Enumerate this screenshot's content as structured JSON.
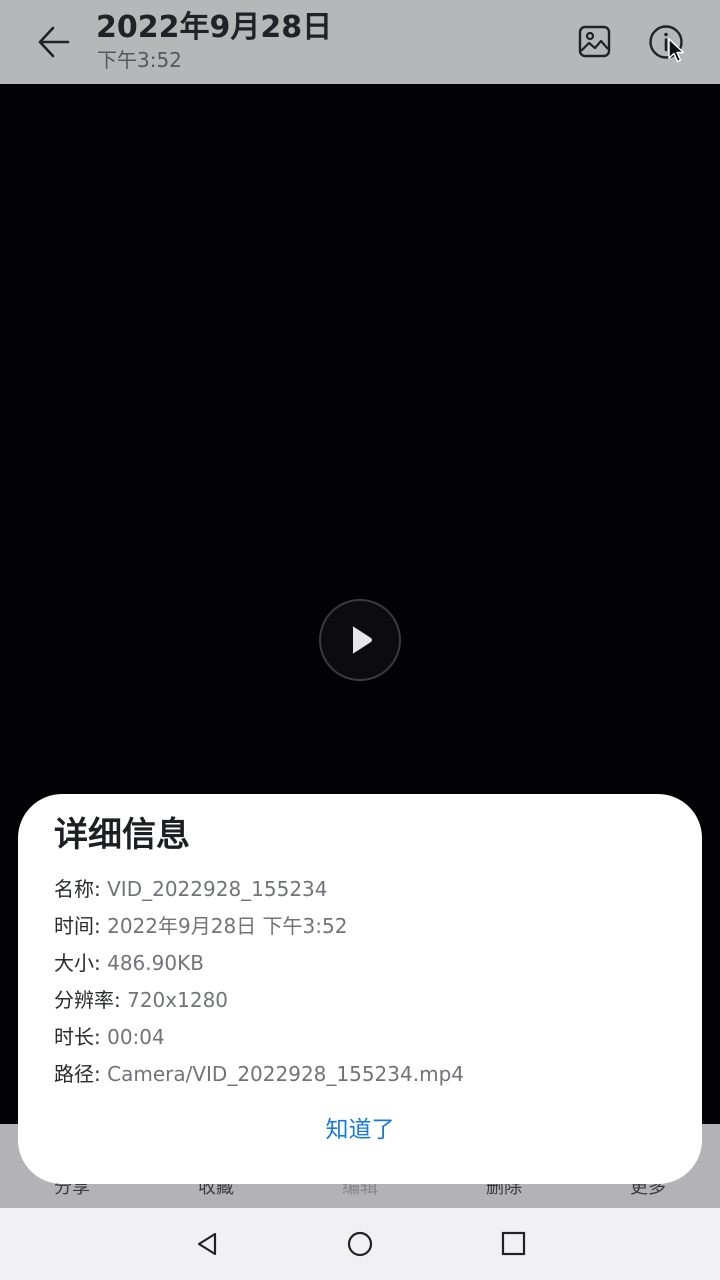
{
  "header": {
    "title": "2022年9月28日",
    "subtitle": "下午3:52",
    "icons": [
      "back-arrow-icon",
      "gallery-icon",
      "info-icon"
    ]
  },
  "video": {
    "play_icon": "play-icon"
  },
  "bottom_bar": {
    "items": [
      {
        "label": "分享"
      },
      {
        "label": "收藏"
      },
      {
        "label": "编辑"
      },
      {
        "label": "删除"
      },
      {
        "label": "更多"
      }
    ]
  },
  "dialog": {
    "title": "详细信息",
    "rows": [
      {
        "key": "名称: ",
        "value": "VID_2022928_155234"
      },
      {
        "key": "时间: ",
        "value": "2022年9月28日 下午3:52"
      },
      {
        "key": "大小: ",
        "value": "486.90KB"
      },
      {
        "key": "分辨率: ",
        "value": "720x1280"
      },
      {
        "key": "时长: ",
        "value": "00:04"
      },
      {
        "key": "路径: ",
        "value": "Camera/VID_2022928_155234.mp4"
      }
    ],
    "ok_label": "知道了"
  },
  "nav": {
    "icons": [
      "nav-back-icon",
      "nav-home-icon",
      "nav-recents-icon"
    ]
  },
  "colors": {
    "accent": "#1778de",
    "topbar": "#b6b7b9",
    "navbar": "#f1f1f3"
  }
}
